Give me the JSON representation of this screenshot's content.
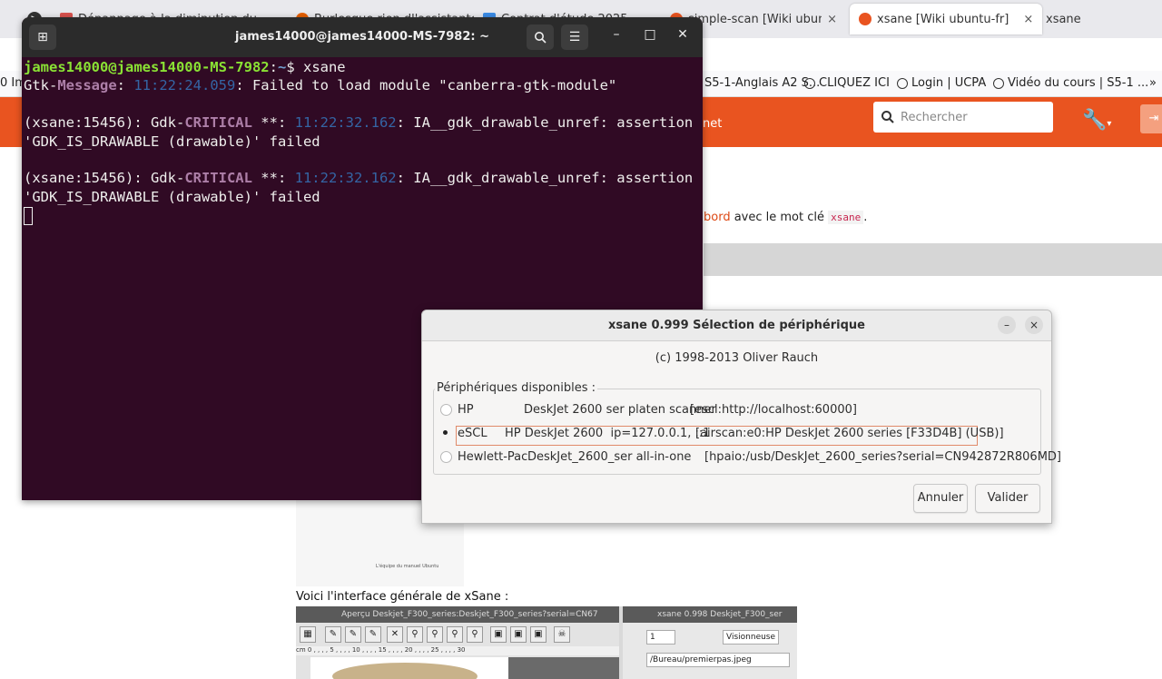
{
  "browser": {
    "tabs": [
      {
        "label": "Dépannage à la diminution du...",
        "color": "#e66000"
      },
      {
        "label": "Burlesque rien dl'assistante",
        "color": "#e66000"
      },
      {
        "label": "Contrat d'étude 2025...",
        "color": "#3c8ce6"
      },
      {
        "label": "simple-scan [Wiki ubuntu-fr]",
        "color": "#e95420"
      },
      {
        "label": "xsane [Wiki ubuntu-fr]",
        "color": "#e95420",
        "active": true
      }
    ],
    "tab_close": "×",
    "trailing_title": "xsane",
    "bookmarks": [
      {
        "label": "S5-1-Anglais A2 S..."
      },
      {
        "label": "CLIQUEZ ICI"
      },
      {
        "label": "Login | UCPA"
      },
      {
        "label": "Vidéo du cours | S5-1 ..."
      }
    ],
    "bookmark_left_fragment": "0 Im",
    "search_placeholder": "Rechercher",
    "header_fragment": "net",
    "page_fragment_link": "bord",
    "page_fragment_text": " avec le mot clé ",
    "page_fragment_code": "xsane",
    "page_fragment_end": ".",
    "doc_caption": "L'équipe du manuel Ubuntu",
    "voici_text": "Voici l'interface générale de xSane :",
    "xsane_preview_title": "Aperçu Deskjet_F300_series:Deskjet_F300_series?serial=CN67",
    "xsane_main_title": "xsane 0.998 Deskjet_F300_ser",
    "xsane_ruler": "cm 0 , , , , 5 , , , , 10 , , , , 15 , , , , 20 , , , , 25 , , , , 30",
    "xsane_field_copies": "1",
    "xsane_field_viewer": "Visionneuse",
    "xsane_field_path": "/Bureau/premierpas.jpeg"
  },
  "terminal": {
    "title": "james14000@james14000-MS-7982: ~",
    "prompt_user": "james14000@james14000-MS-7982",
    "prompt_sep": ":",
    "prompt_path": "~",
    "prompt_end": "$ ",
    "command": "xsane",
    "line2_a": "Gtk-",
    "line2_b": "Message",
    "line2_c": ": ",
    "line2_time": "11:22:24.059",
    "line2_d": ": Failed to load module \"canberra-gtk-module\"",
    "err1_a": "(xsane:15456): Gdk-",
    "err1_b": "CRITICAL",
    "err1_c": " **: ",
    "err1_time": "11:22:32.162",
    "err1_d": ": IA__gdk_drawable_unref: assertion",
    "err1_e": "'GDK_IS_DRAWABLE (drawable)' failed",
    "err2_a": "(xsane:15456): Gdk-",
    "err2_b": "CRITICAL",
    "err2_c": " **: ",
    "err2_time": "11:22:32.162",
    "err2_d": ": IA__gdk_drawable_unref: assertion",
    "err2_e": "'GDK_IS_DRAWABLE (drawable)' failed"
  },
  "dialog": {
    "title": "xsane 0.999 Sélection de périphérique",
    "minimize": "–",
    "close": "×",
    "copyright": "(c) 1998-2013 Oliver Rauch",
    "frame_label": "Périphériques disponibles :",
    "devices": [
      {
        "vendor": "HP",
        "model": "DeskJet 2600 ser platen scanner",
        "address": "[escl:http://localhost:60000]",
        "selected": false
      },
      {
        "vendor": "eSCL",
        "model": "HP DeskJet 2600  ip=127.0.0.1, ::1",
        "address": "[airscan:e0:HP DeskJet 2600 series [F33D4B] (USB)]",
        "selected": true
      },
      {
        "vendor": "Hewlett-Pac",
        "model": "DeskJet_2600_ser all-in-one",
        "address": "[hpaio:/usb/DeskJet_2600_series?serial=CN942872R806MD]",
        "selected": false
      }
    ],
    "cancel_label": "Annuler",
    "ok_label": "Valider"
  }
}
